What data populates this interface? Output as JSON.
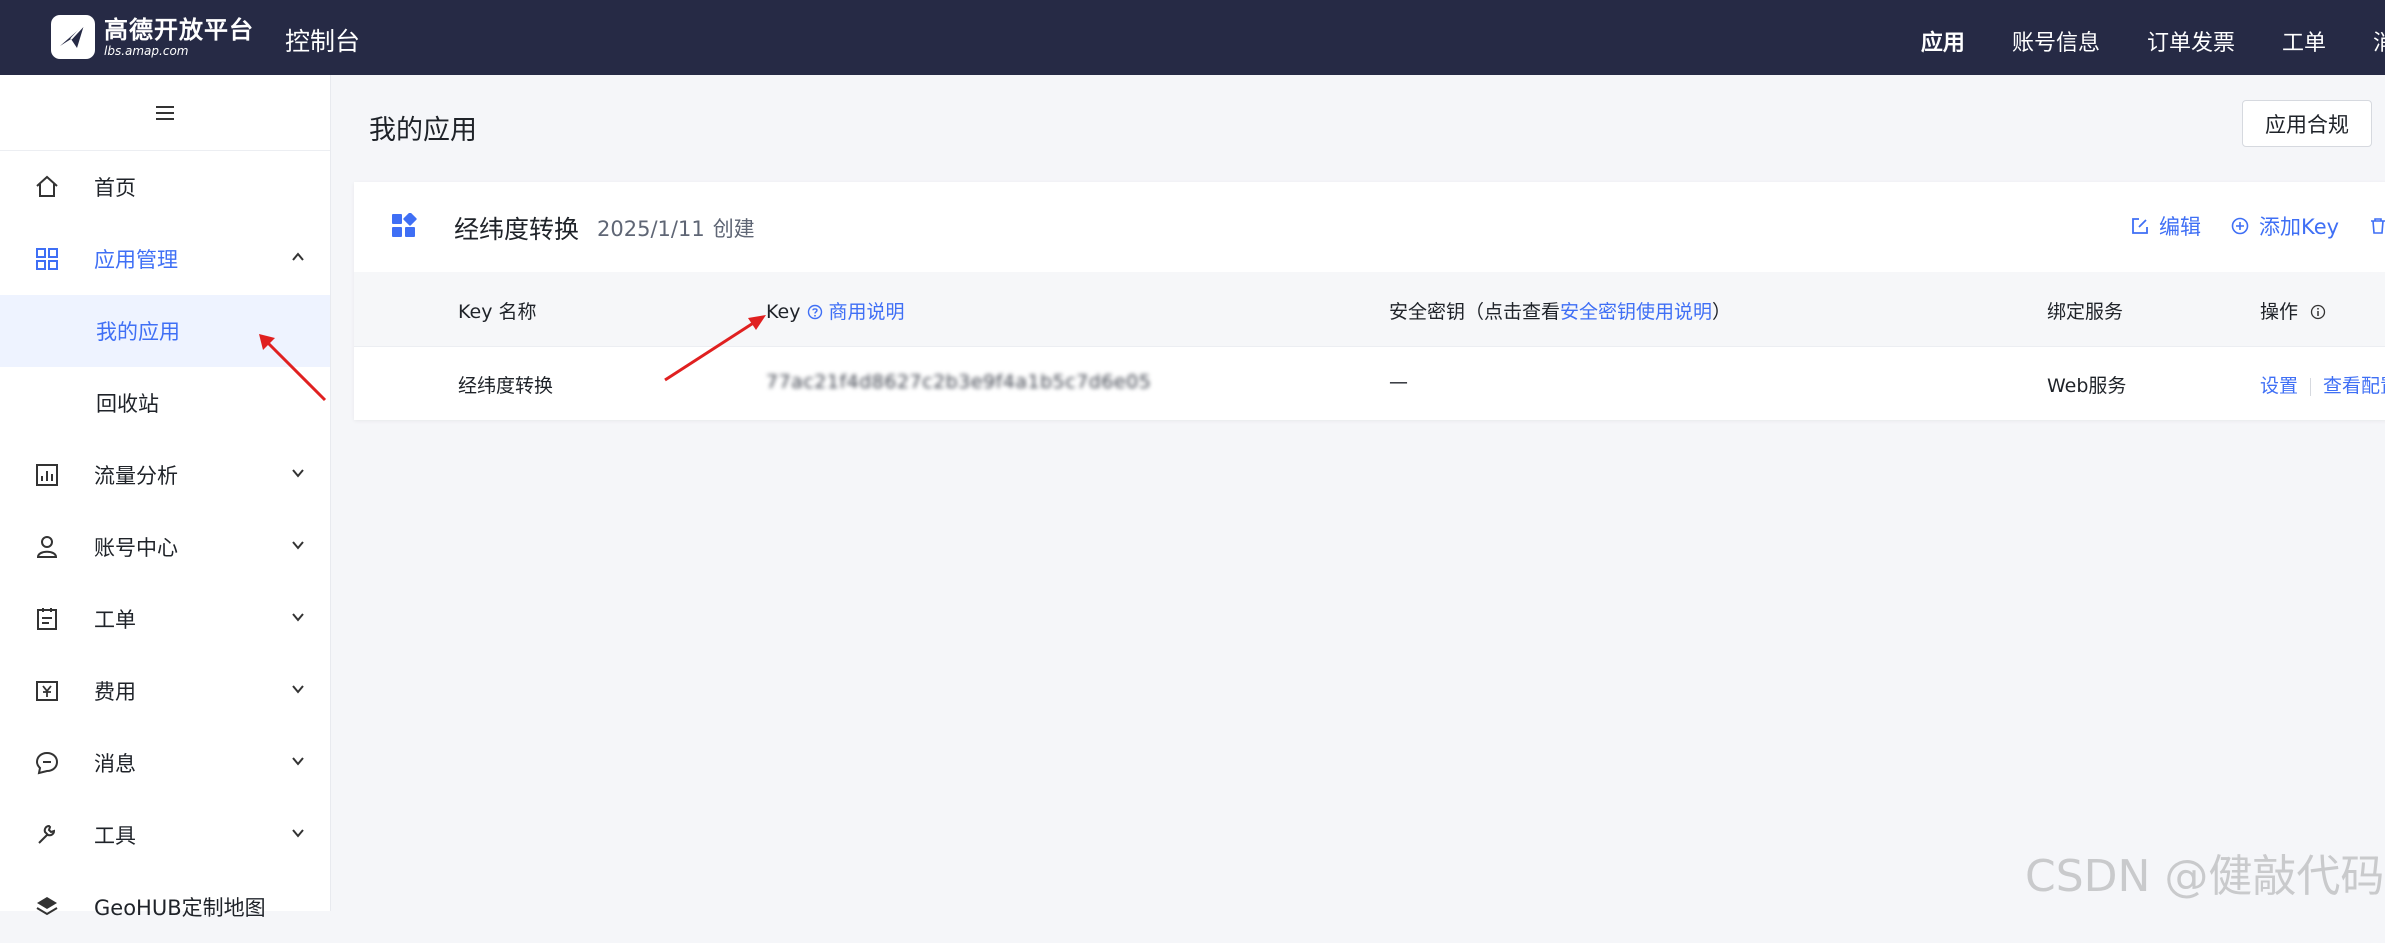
{
  "header": {
    "logo_cn": "高德开放平台",
    "logo_domain": "lbs.amap.com",
    "console_title": "控制台",
    "nav": [
      "应用",
      "账号信息",
      "订单发票",
      "工单",
      "消"
    ]
  },
  "sidebar": {
    "items": [
      {
        "label": "首页",
        "icon": "home-icon"
      },
      {
        "label": "应用管理",
        "icon": "grid-icon",
        "sub": [
          "我的应用",
          "回收站"
        ]
      },
      {
        "label": "流量分析",
        "icon": "chart-icon"
      },
      {
        "label": "账号中心",
        "icon": "user-icon"
      },
      {
        "label": "工单",
        "icon": "clipboard-icon"
      },
      {
        "label": "费用",
        "icon": "yen-icon"
      },
      {
        "label": "消息",
        "icon": "message-icon"
      },
      {
        "label": "工具",
        "icon": "wrench-icon"
      },
      {
        "label": "GeoHUB定制地图",
        "icon": "layers-icon"
      }
    ]
  },
  "main": {
    "title": "我的应用",
    "compliance_button": "应用合规",
    "app": {
      "name": "经纬度转换",
      "created_date": "2025/1/11",
      "created_suffix": "创建",
      "actions": {
        "edit": "编辑",
        "add_key": "添加Key"
      }
    },
    "table": {
      "headers": {
        "key_name": "Key 名称",
        "key": "Key",
        "key_link": "商用说明",
        "secret_prefix": "安全密钥（点击查看",
        "secret_link": "安全密钥使用说明",
        "secret_suffix": "）",
        "service": "绑定服务",
        "ops": "操作"
      },
      "row": {
        "key_name": "经纬度转换",
        "key": "77ac21f4d8627c2b3e9f4a1b5c7d6e05",
        "secret": "—",
        "service": "Web服务",
        "op_settings": "设置",
        "op_view": "查看配置"
      }
    }
  },
  "watermark": "CSDN @健敲代码",
  "colors": {
    "topbar": "#262a45",
    "accent": "#3f6ff5",
    "annotation_arrow": "#e02020"
  }
}
